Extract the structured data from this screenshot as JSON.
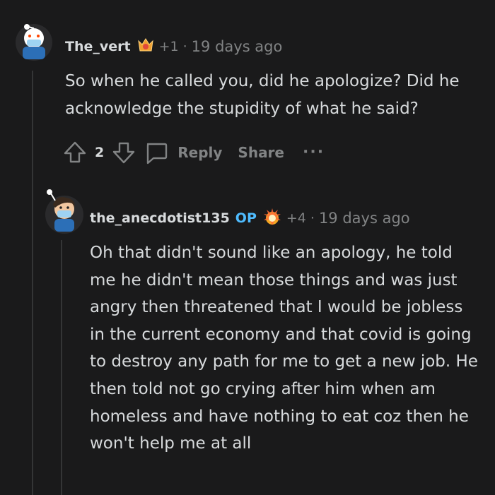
{
  "comments": [
    {
      "username": "The_vert",
      "op_tag": "",
      "karma": "+1",
      "separator": "·",
      "time": "19 days ago",
      "body": "So when he called you, did he apologize? Did he acknowledge the stupidity of what he said?",
      "score": "2",
      "reply_label": "Reply",
      "share_label": "Share",
      "more_label": "···"
    },
    {
      "username": "the_anecdotist135",
      "op_tag": "OP",
      "karma": "+4",
      "separator": "·",
      "time": "19 days ago",
      "body": "Oh that didn't sound like an apology, he told me he didn't mean those things and was just angry then threatened that I would be jobless in the current economy and that covid is going to destroy any path for me to get a new job. He then told not go crying after him when am homeless and have nothing to eat coz then he won't help me at all"
    }
  ],
  "colors": {
    "background": "#1a1a1b",
    "text": "#d7dadc",
    "muted": "#818384",
    "op_accent": "#4fbcff",
    "thread_line": "#343536"
  },
  "icons": [
    "avatar",
    "award-badge-icon",
    "upvote-icon",
    "downvote-icon",
    "comment-bubble-icon",
    "more-icon"
  ]
}
